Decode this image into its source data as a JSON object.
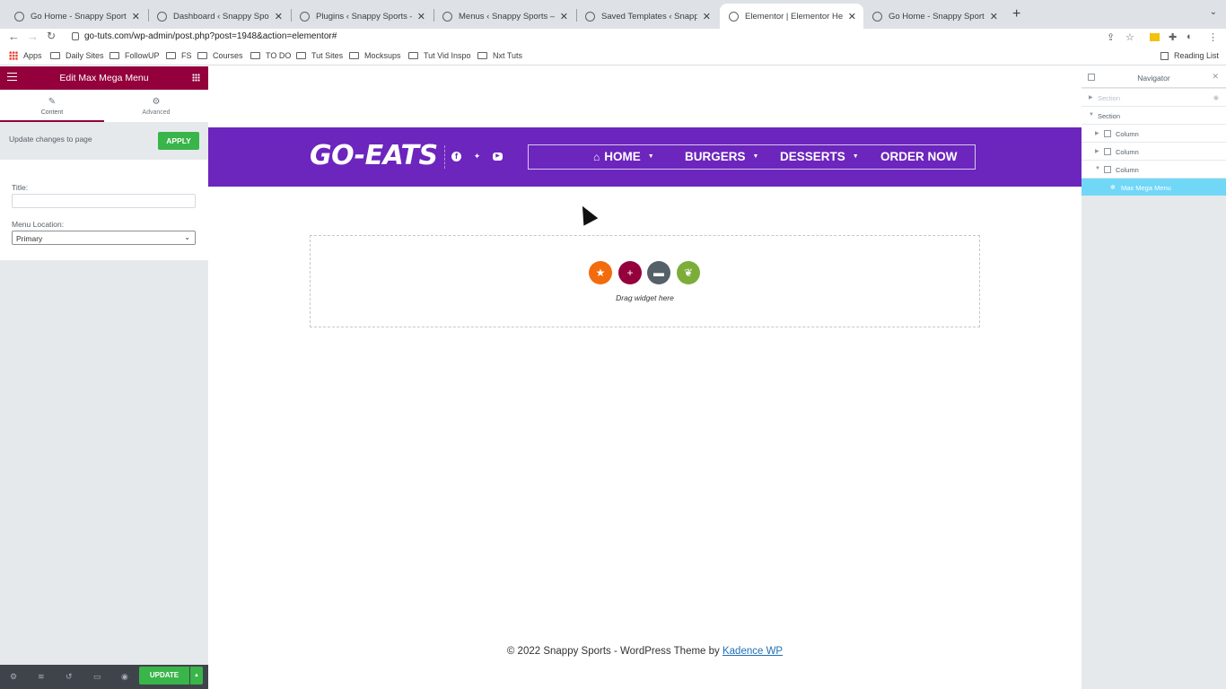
{
  "browser": {
    "tabs": [
      {
        "title": "Go Home - Snappy Sports",
        "active": false
      },
      {
        "title": "Dashboard ‹ Snappy Sports —",
        "active": false
      },
      {
        "title": "Plugins ‹ Snappy Sports — Wo",
        "active": false
      },
      {
        "title": "Menus ‹ Snappy Sports — Wor",
        "active": false
      },
      {
        "title": "Saved Templates ‹ Snappy Spo",
        "active": false
      },
      {
        "title": "Elementor | Elementor Header",
        "active": true
      },
      {
        "title": "Go Home - Snappy Sports",
        "active": false
      }
    ],
    "url": "go-tuts.com/wp-admin/post.php?post=1948&action=elementor#",
    "bookmarks": [
      "Apps",
      "Daily Sites",
      "FollowUP",
      "FS",
      "Courses",
      "TO DO",
      "Tut Sites",
      "Mocksups",
      "Tut Vid Inspo",
      "Nxt Tuts"
    ],
    "reading_list": "Reading List"
  },
  "panel": {
    "title": "Edit Max Mega Menu",
    "tabs": {
      "content": "Content",
      "advanced": "Advanced"
    },
    "update_changes_label": "Update changes to page",
    "apply_label": "APPLY",
    "title_label": "Title:",
    "title_value": "",
    "menu_location_label": "Menu Location:",
    "menu_location_value": "Primary",
    "update_label": "UPDATE"
  },
  "canvas": {
    "logo": "GO-EATS",
    "menu": [
      "HOME",
      "BURGERS",
      "DESSERTS",
      "ORDER NOW"
    ],
    "drag_text": "Drag widget here",
    "footer_prefix": "© 2022 Snappy Sports - WordPress Theme by ",
    "footer_link": "Kadence WP"
  },
  "navigator": {
    "title": "Navigator",
    "items": [
      "Section",
      "Section",
      "Column",
      "Column",
      "Column",
      "Max Mega Menu"
    ]
  },
  "colors": {
    "elementor_brand": "#93003c",
    "header_purple": "#6c25bd",
    "apply_green": "#39b54a",
    "navigator_selected": "#71d7f7"
  }
}
